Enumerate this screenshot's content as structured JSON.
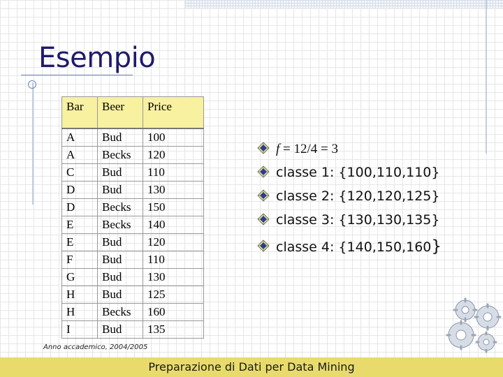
{
  "slide": {
    "title": "Esempio"
  },
  "table": {
    "headers": [
      "Bar",
      "Beer",
      "Price"
    ],
    "rows": [
      [
        "A",
        "Bud",
        "100"
      ],
      [
        "A",
        "Becks",
        "120"
      ],
      [
        "C",
        "Bud",
        "110"
      ],
      [
        "D",
        "Bud",
        "130"
      ],
      [
        "D",
        "Becks",
        "150"
      ],
      [
        "E",
        "Becks",
        "140"
      ],
      [
        "E",
        "Bud",
        "120"
      ],
      [
        "F",
        "Bud",
        "110"
      ],
      [
        "G",
        "Bud",
        "130"
      ],
      [
        "H",
        "Bud",
        "125"
      ],
      [
        "H",
        "Becks",
        "160"
      ],
      [
        "I",
        "Bud",
        "135"
      ]
    ]
  },
  "bullets": {
    "formula_var": "f",
    "formula_rest": " = 12/4 = 3",
    "class1": "classe 1: {100,110,110}",
    "class2": "classe 2: {120,120,125}",
    "class3": "classe 3: {130,130,135}",
    "class4_text": "classe 4: {140,150,160",
    "class4_brace": "}"
  },
  "footer": {
    "left": "Anno accademico, 2004/2005",
    "center": "Preparazione di Dati per Data Mining"
  },
  "icons": {
    "bullet": "diamond-bullet-icon",
    "decoration": "gears-icon"
  },
  "colors": {
    "title": "#1f1a6b",
    "header_fill": "#f7f1a0",
    "footer_bar": "#e8db6c"
  }
}
